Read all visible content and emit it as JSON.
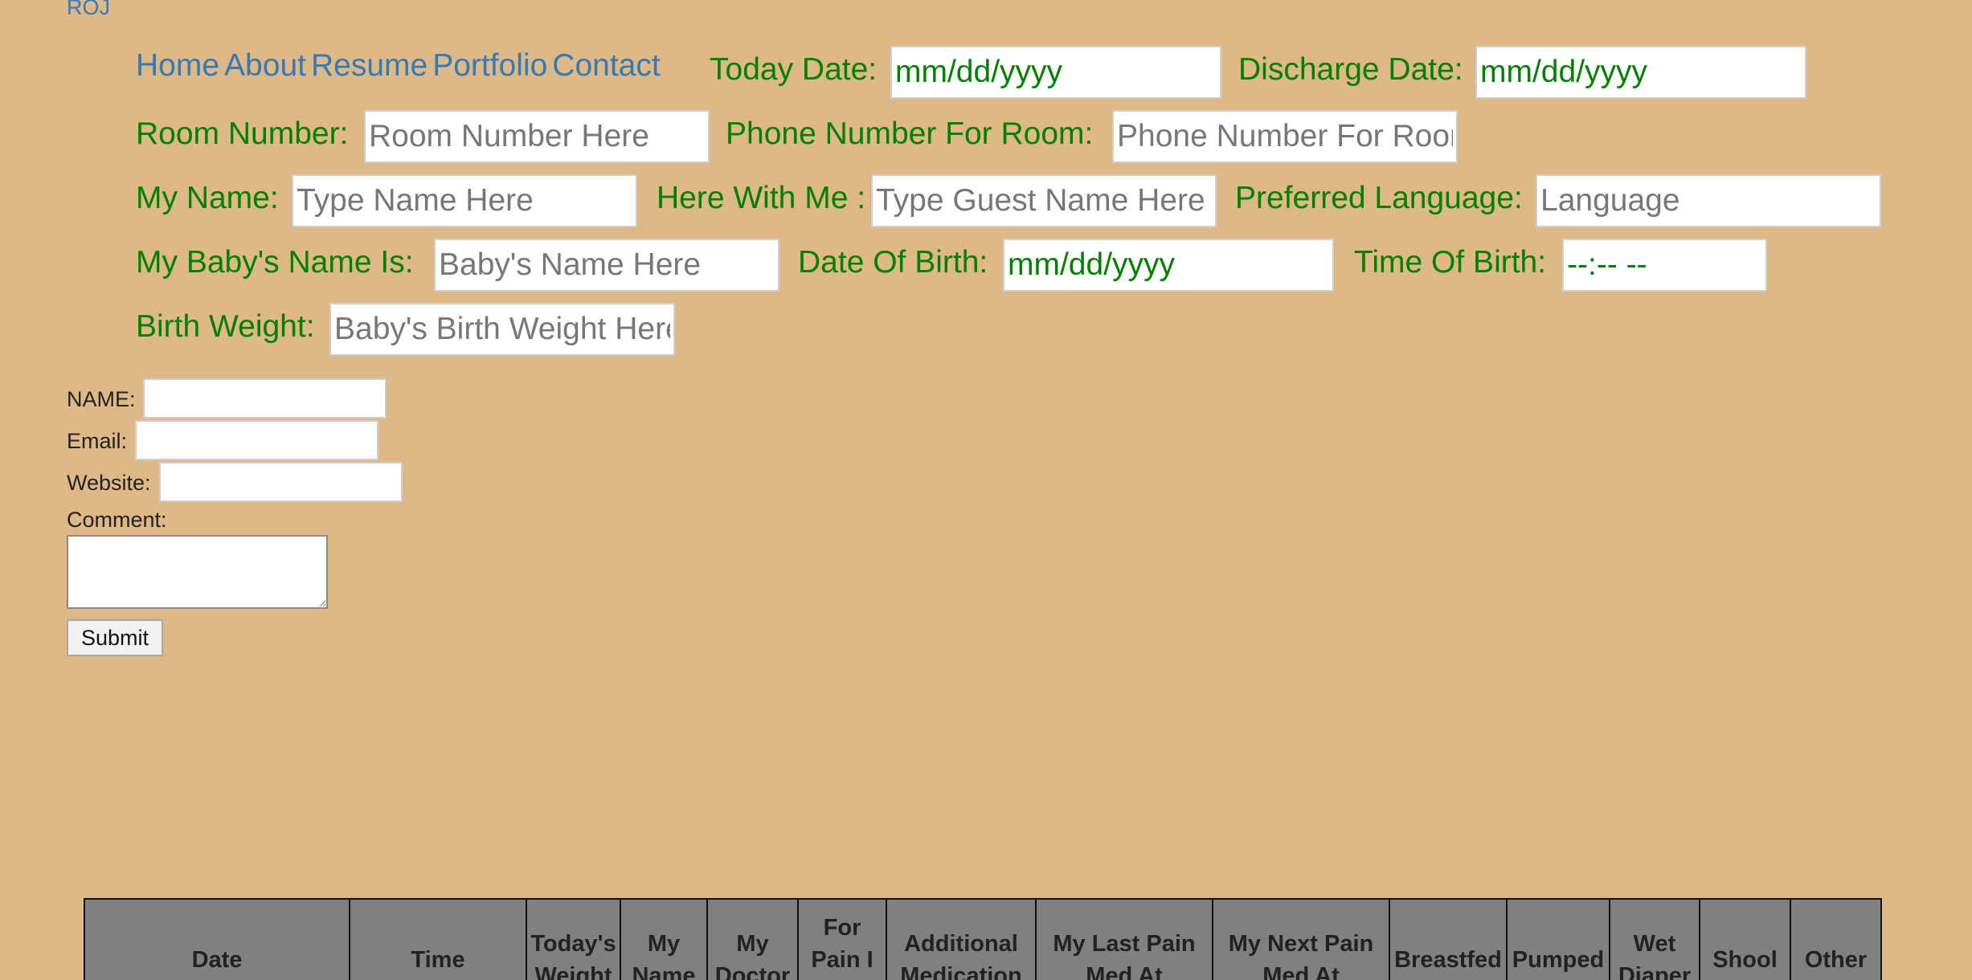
{
  "brand": "ROJ",
  "nav": [
    "Home",
    "About",
    "Resume",
    "Portfolio",
    "Contact"
  ],
  "patient": {
    "today_date": {
      "label": "Today Date:",
      "value": "mm/dd/yyyy"
    },
    "discharge_date": {
      "label": "Discharge Date:",
      "value": "mm/dd/yyyy"
    },
    "room_number": {
      "label": "Room Number:",
      "placeholder": "Room Number Here"
    },
    "room_phone": {
      "label": "Phone Number For Room:",
      "placeholder": "Phone Number For Room"
    },
    "my_name": {
      "label": "My Name:",
      "placeholder": "Type Name Here"
    },
    "guest": {
      "label": "Here With Me :",
      "placeholder": "Type Guest Name Here"
    },
    "language": {
      "label": "Preferred Language:",
      "placeholder": "Language"
    },
    "baby_name": {
      "label": "My Baby's Name Is:",
      "placeholder": "Baby's Name Here"
    },
    "dob": {
      "label": "Date Of Birth:",
      "value": "mm/dd/yyyy"
    },
    "tob": {
      "label": "Time Of Birth:",
      "value": "--:-- --"
    },
    "birth_weight": {
      "label": "Birth Weight:",
      "placeholder": "Baby's Birth Weight Here"
    }
  },
  "contact_form": {
    "name_label": "NAME:",
    "email_label": "Email:",
    "website_label": "Website:",
    "comment_label": "Comment:",
    "submit_label": "Submit"
  },
  "table": {
    "headers": [
      "Date",
      "Time",
      "Today's Weight",
      "My Name",
      "My Doctor",
      "For Pain I Am",
      "Additional Medication",
      "My Last Pain Med At",
      "My Next Pain Med At",
      "Breastfed",
      "Pumped",
      "Wet Diaper",
      "Shool",
      "Other"
    ]
  }
}
